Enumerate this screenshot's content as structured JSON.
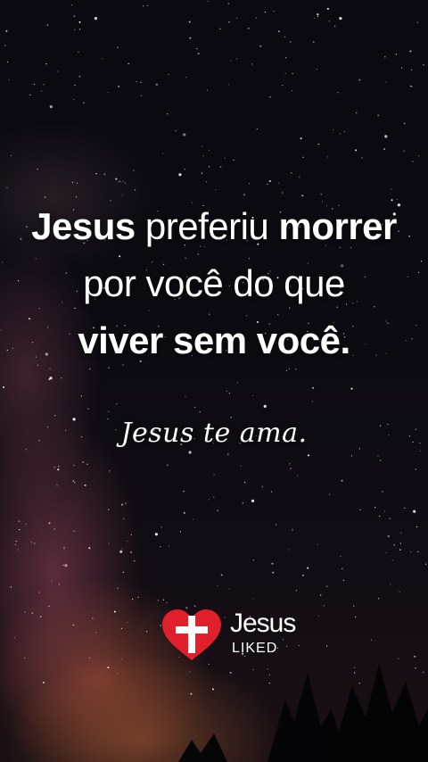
{
  "quote": {
    "line1_part1": "Jesus",
    "line1_part2": " preferiu ",
    "line1_part3": "morrer",
    "line2": "por você do que",
    "line3": "viver sem você."
  },
  "subtitle": "Jesus te ama.",
  "logo": {
    "word": "Jesus",
    "sub": "LIKED"
  },
  "colors": {
    "heart": "#e0202a",
    "text": "#ffffff"
  }
}
